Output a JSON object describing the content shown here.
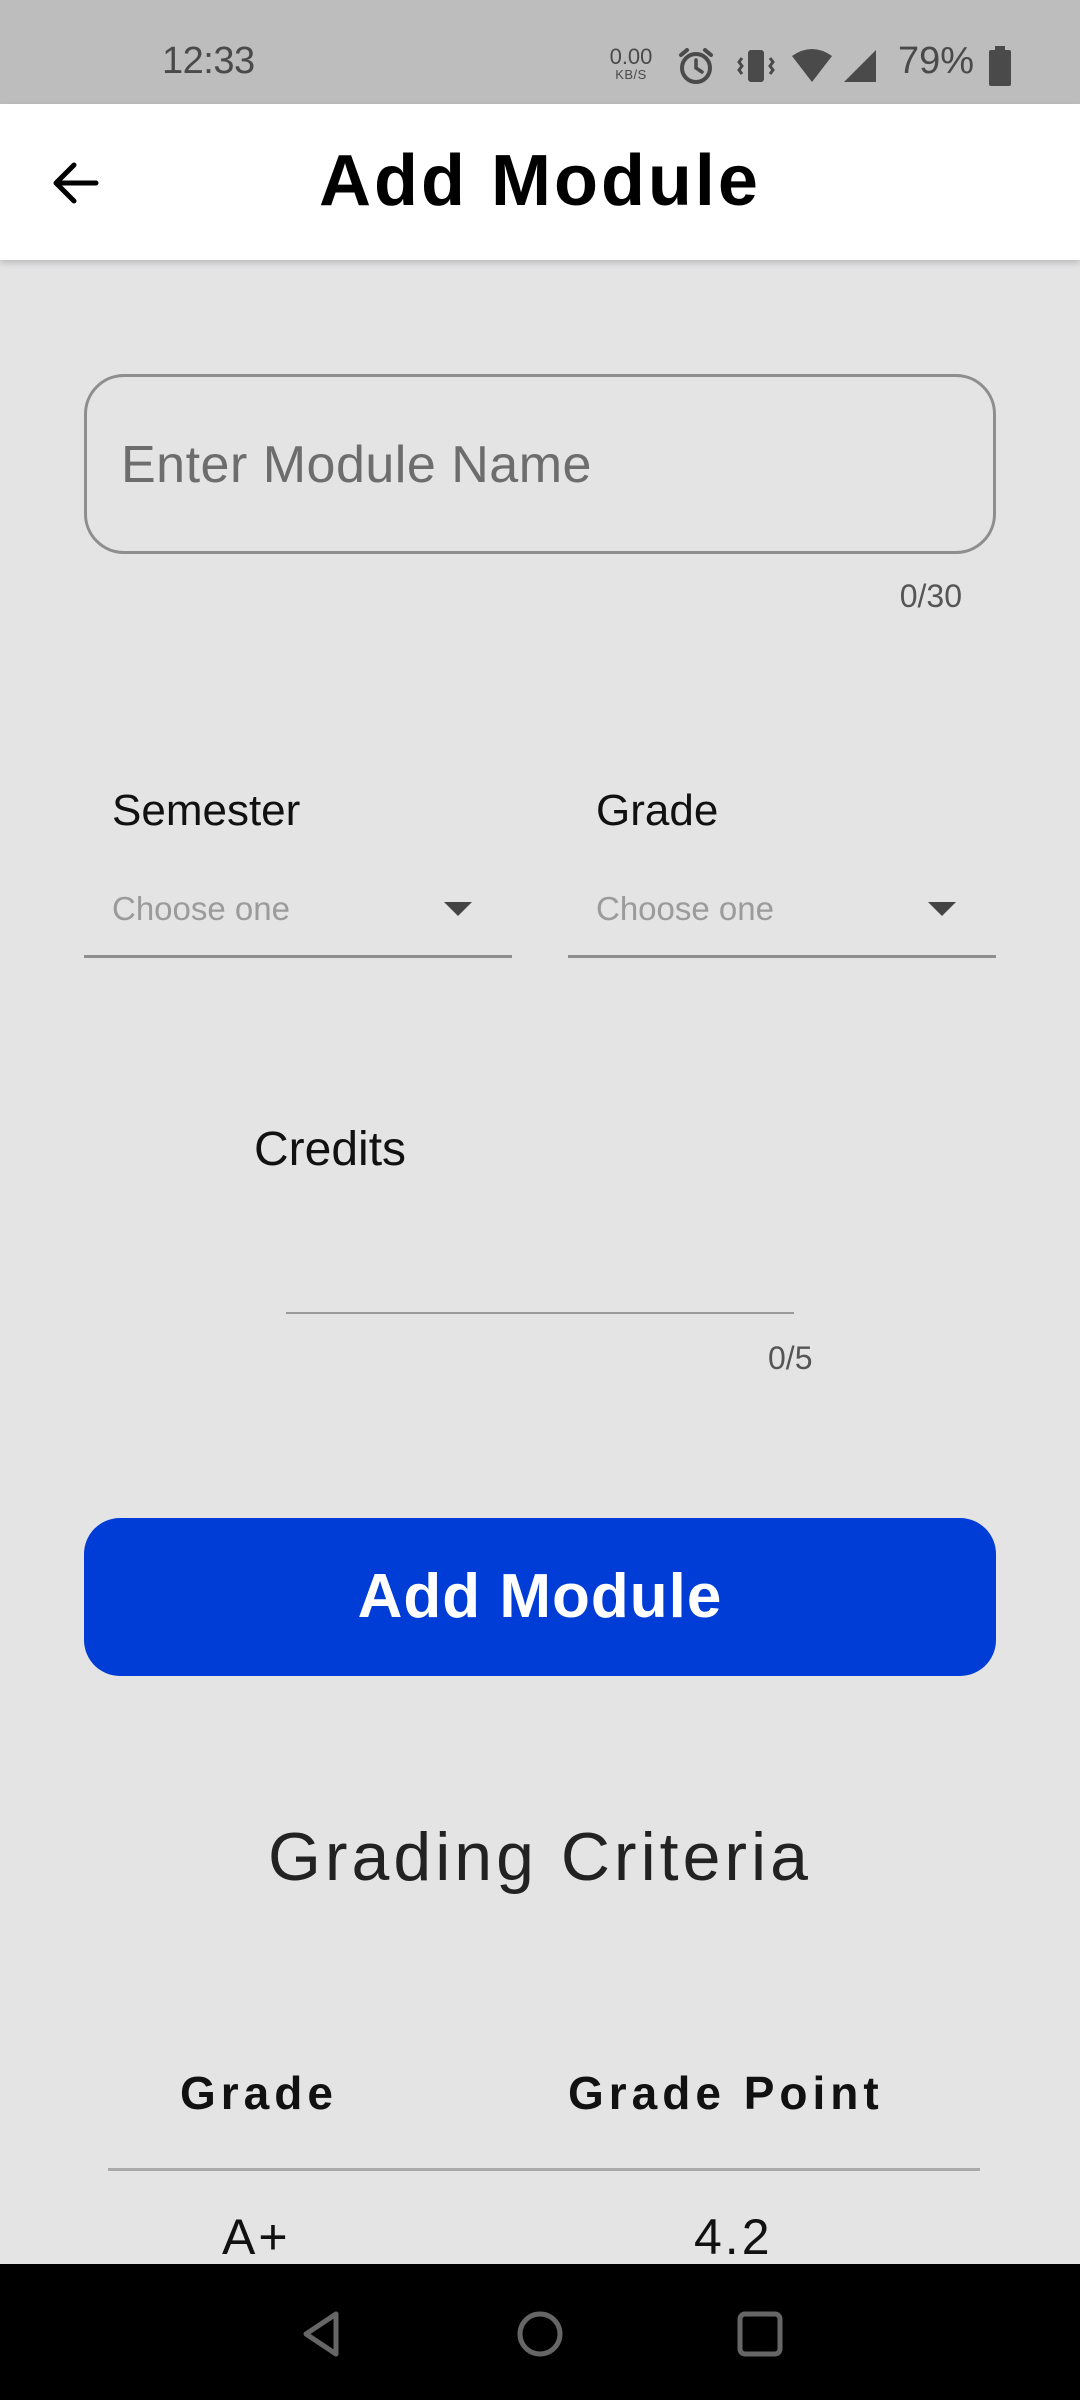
{
  "status_bar": {
    "time": "12:33",
    "net_speed_value": "0.00",
    "net_speed_unit": "KB/S",
    "battery_percent": "79%",
    "icons": [
      "alarm-icon",
      "vibrate-icon",
      "wifi-icon",
      "cell-signal-icon",
      "battery-icon"
    ]
  },
  "app_bar": {
    "title": "Add Module",
    "back_icon": "arrow-left-icon"
  },
  "form": {
    "module_name": {
      "placeholder": "Enter Module Name",
      "counter": "0/30"
    },
    "semester": {
      "label": "Semester",
      "value": "Choose one"
    },
    "grade": {
      "label": "Grade",
      "value": "Choose one"
    },
    "credits": {
      "label": "Credits",
      "value": "",
      "counter": "0/5"
    },
    "submit_label": "Add Module"
  },
  "criteria": {
    "title": "Grading Criteria",
    "headers": [
      "Grade",
      "Grade Point"
    ],
    "rows": [
      {
        "grade": "A+",
        "point": "4.2"
      }
    ]
  },
  "colors": {
    "accent": "#003cd6",
    "background": "#e4e4e5",
    "app_bar": "#ffffff",
    "status_bar": "#bdbdbd",
    "nav_bar": "#000000"
  }
}
